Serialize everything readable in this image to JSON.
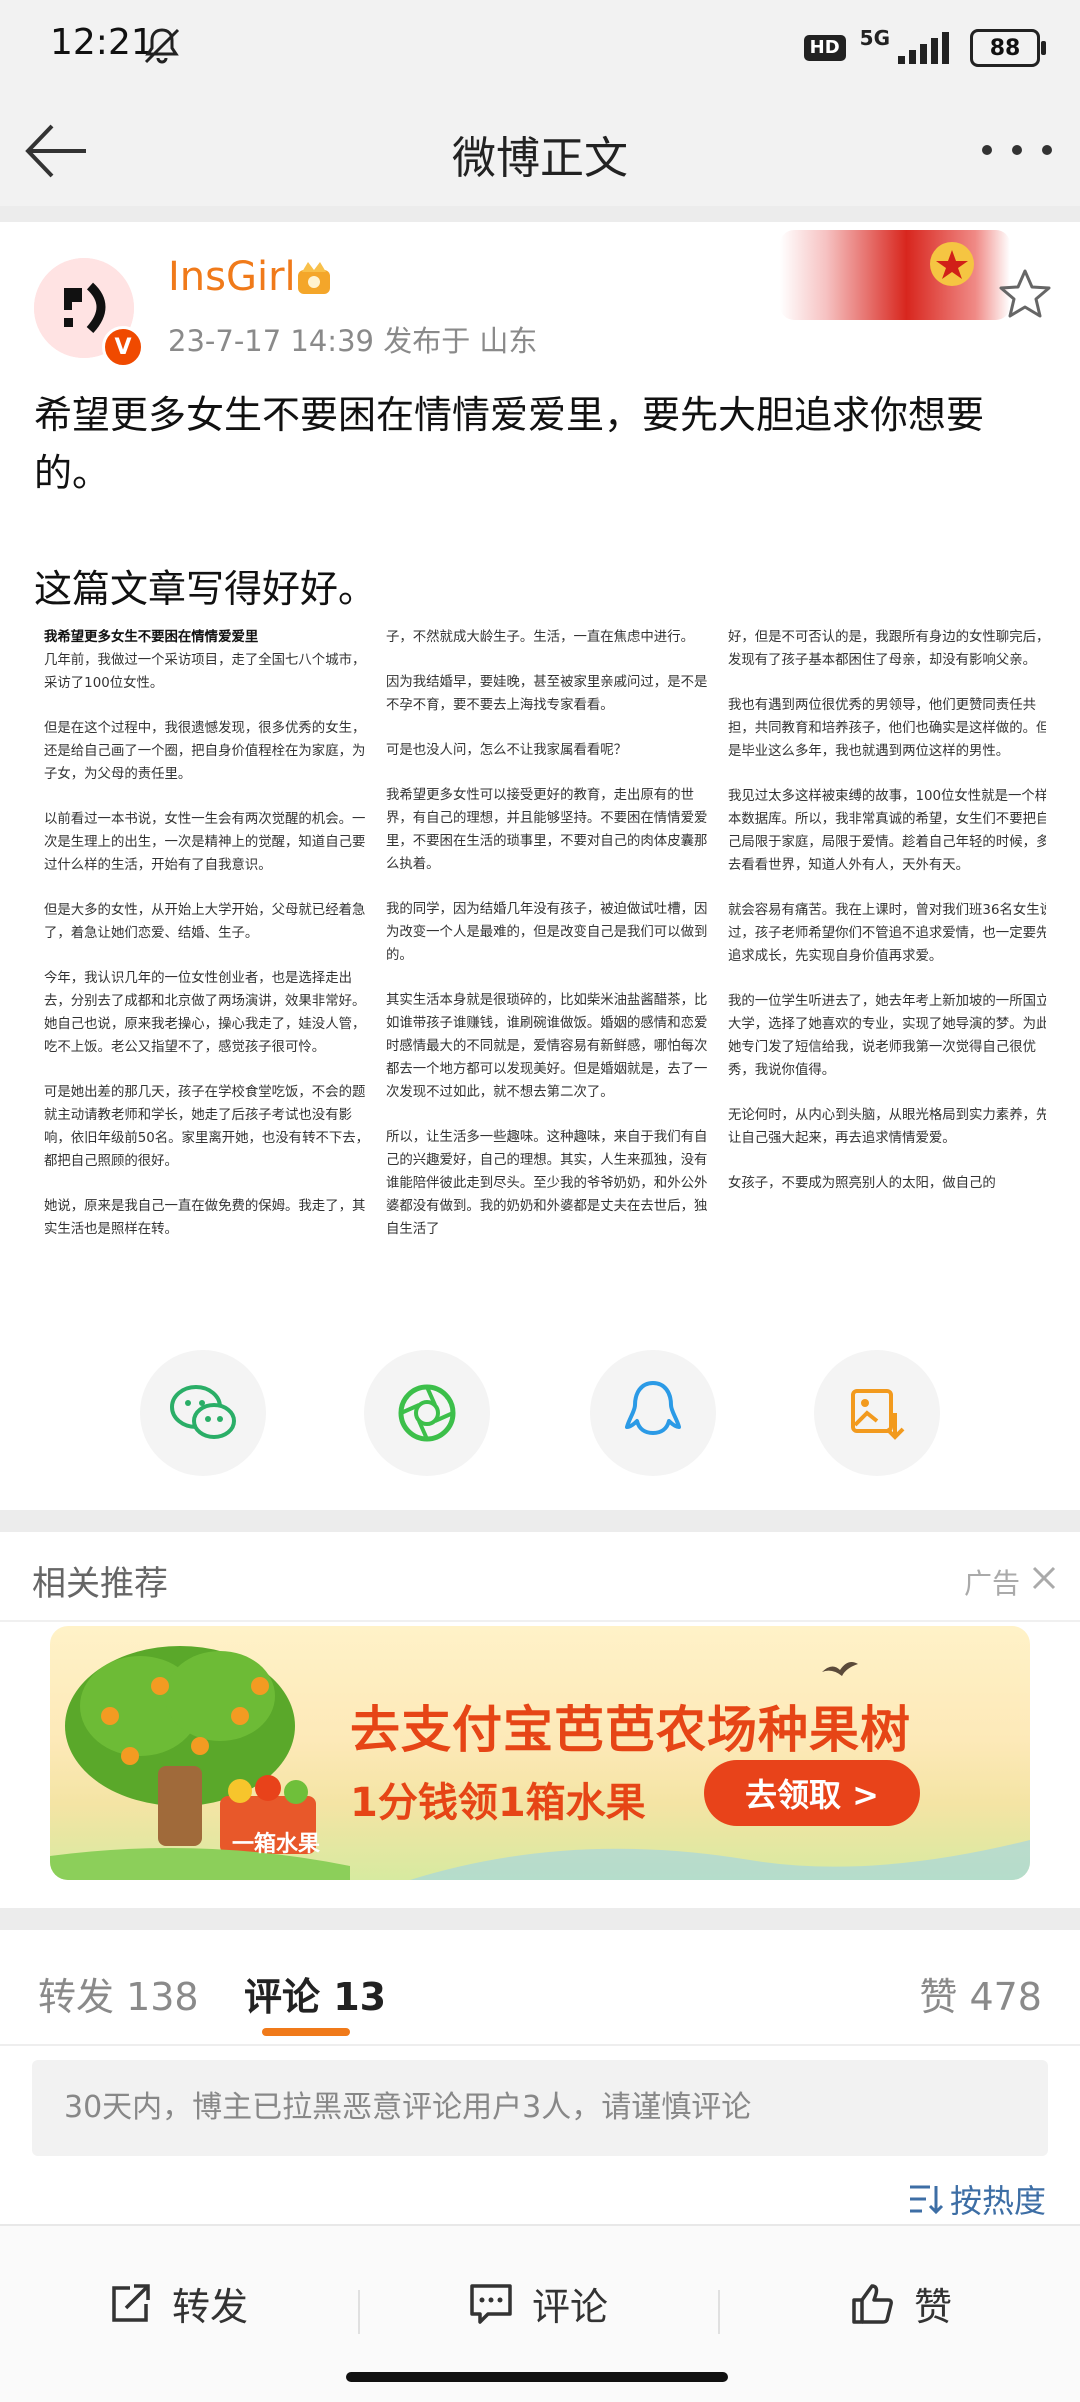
{
  "status_bar": {
    "time": "12:21",
    "network": "5G",
    "hd": "HD",
    "battery": "88"
  },
  "nav": {
    "title": "微博正文"
  },
  "post": {
    "username": "InsGirl",
    "verified_mark": "V",
    "meta": "23-7-17 14:39  发布于 山东",
    "text_line1": "希望更多女生不要困在情情爱爱里，要先大胆追求你想要的。",
    "text_line2": "这篇文章写得好好。"
  },
  "article_image": {
    "col1": [
      {
        "head": "我希望更多女生不要困在情情爱爱里",
        "text": "几年前，我做过一个采访项目，走了全国七八个城市，采访了100位女性。"
      },
      {
        "text": "但是在这个过程中，我很遗憾发现，很多优秀的女生，还是给自己画了一个圈，把自身价值程栓在为家庭，为子女，为父母的责任里。"
      },
      {
        "text": "以前看过一本书说，女性一生会有两次觉醒的机会。一次是生理上的出生，一次是精神上的觉醒，知道自己要过什么样的生活，开始有了自我意识。"
      },
      {
        "text": "但是大多的女性，从开始上大学开始，父母就已经着急了，着急让她们恋爱、结婚、生子。"
      },
      {
        "text": "今年，我认识几年的一位女性创业者，也是选择走出去，分别去了成都和北京做了两场演讲，效果非常好。她自己也说，原来我老操心，操心我走了，娃没人管，吃不上饭。老公又指望不了，感觉孩子很可怜。"
      },
      {
        "text": "可是她出差的那几天，孩子在学校食堂吃饭，不会的题就主动请教老师和学长，她走了后孩子考试也没有影响，依旧年级前50名。家里离开她，也没有转不下去，都把自己照顾的很好。"
      },
      {
        "text": "她说，原来是我自己一直在做免费的保姆。我走了，其实生活也是照样在转。"
      }
    ],
    "col2": [
      {
        "text": "子，不然就成大龄生子。生活，一直在焦虑中进行。"
      },
      {
        "text": "因为我结婚早，要娃晚，甚至被家里亲戚问过，是不是不孕不育，要不要去上海找专家看看。"
      },
      {
        "text": "可是也没人问，怎么不让我家属看看呢？"
      },
      {
        "text": "我希望更多女性可以接受更好的教育，走出原有的世界，有自己的理想，并且能够坚持。不要困在情情爱爱里，不要困在生活的琐事里，不要对自己的肉体皮囊那么执着。"
      },
      {
        "text": "我的同学，因为结婚几年没有孩子，被迫做试吐槽，因为改变一个人是最难的，但是改变自己是我们可以做到的。"
      },
      {
        "text": "其实生活本身就是很琐碎的，比如柴米油盐酱醋茶，比如谁带孩子谁赚钱，谁刷碗谁做饭。婚姻的感情和恋爱时感情最大的不同就是，爱情容易有新鲜感，哪怕每次都去一个地方都可以发现美好。但是婚姻就是，去了一次发现不过如此，就不想去第二次了。"
      },
      {
        "text": "所以，让生活多一些趣味。这种趣味，来自于我们有自己的兴趣爱好，自己的理想。其实，人生来孤独，没有谁能陪伴彼此走到尽头。至少我的爷爷奶奶，和外公外婆都没有做到。我的奶奶和外婆都是丈夫在去世后，独自生活了"
      }
    ],
    "col3": [
      {
        "text": "好，但是不可否认的是，我跟所有身边的女性聊完后，发现有了孩子基本都困住了母亲，却没有影响父亲。"
      },
      {
        "text": "我也有遇到两位很优秀的男领导，他们更赞同责任共担，共同教育和培养孩子，他们也确实是这样做的。但是毕业这么多年，我也就遇到两位这样的男性。"
      },
      {
        "text": "我见过太多这样被束缚的故事，100位女性就是一个样本数据库。所以，我非常真诚的希望，女生们不要把自己局限于家庭，局限于爱情。趁着自己年轻的时候，多去看看世界，知道人外有人，天外有天。"
      },
      {
        "text": "就会容易有痛苦。我在上课时，曾对我们班36名女生说过，孩子老师希望你们不管追不追求爱情，也一定要先追求成长，先实现自身价值再求爱。"
      },
      {
        "text": "我的一位学生听进去了，她去年考上新加坡的一所国立大学，选择了她喜欢的专业，实现了她导演的梦。为此她专门发了短信给我，说老师我第一次觉得自己很优秀，我说你值得。"
      },
      {
        "text": "无论何时，从内心到头脑，从眼光格局到实力素养，先让自己强大起来，再去追求情情爱爱。"
      },
      {
        "text": "女孩子，不要成为照亮别人的太阳，做自己的"
      }
    ]
  },
  "share": {
    "items": [
      "wechat-icon",
      "moments-icon",
      "qq-icon",
      "save-image-icon"
    ]
  },
  "recommend": {
    "title": "相关推荐",
    "ad_label": "广告"
  },
  "ad": {
    "title": "去支付宝芭芭农场种果树",
    "subtitle": "1分钱领1箱水果",
    "cta": "去领取 >",
    "box_label": "一箱水果"
  },
  "tabs": {
    "repost": "转发 138",
    "comment": "评论 13",
    "like": "赞 478"
  },
  "notice": "30天内，博主已拉黑恶意评论用户3人，请谨慎评论",
  "sort": "按热度",
  "bottom_bar": {
    "repost": "转发",
    "comment": "评论",
    "like": "赞"
  },
  "colors": {
    "accent_orange": "#f07a1a",
    "ad_red": "#e64516",
    "link_blue": "#3d6ea5"
  }
}
